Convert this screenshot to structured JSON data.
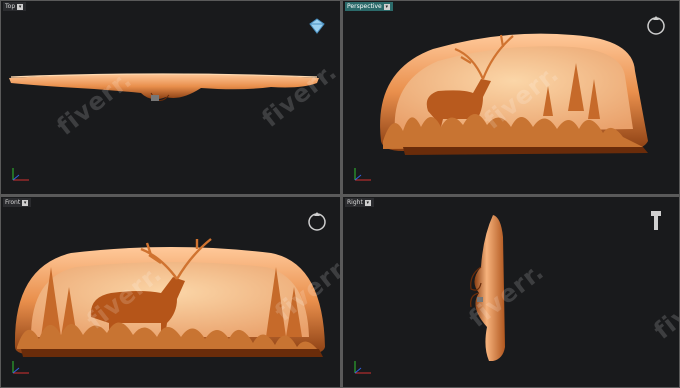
{
  "viewports": {
    "top": {
      "label": "Top"
    },
    "perspective": {
      "label": "Perspective"
    },
    "front": {
      "label": "Front"
    },
    "right": {
      "label": "Right"
    }
  },
  "watermark": {
    "text": "fiverr."
  },
  "colors": {
    "viewport_bg": "#191a1c",
    "frame": "#5a5a5a",
    "model_light": "#f6b27c",
    "model_mid": "#d9823f",
    "model_dark": "#8a3e12",
    "active_label": "#2b6a6a",
    "axis_x": "#d43030",
    "axis_y": "#30c030",
    "axis_z": "#3060e0"
  },
  "icons": {
    "top_nav": "view-cube-icon",
    "perspective_nav": "orbit-icon",
    "front_nav": "orbit-icon",
    "right_nav": "view-cube-icon"
  }
}
